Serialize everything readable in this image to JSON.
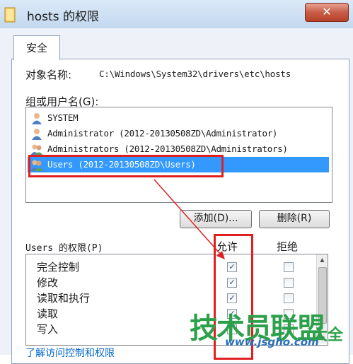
{
  "window": {
    "title": "hosts 的权限",
    "close_glyph": "✕"
  },
  "tabs": [
    {
      "label": "安全"
    }
  ],
  "object": {
    "label": "对象名称:",
    "value": "C:\\Windows\\System32\\drivers\\etc\\hosts"
  },
  "group": {
    "label": "组或用户名(G):",
    "items": [
      {
        "name": "SYSTEM",
        "icon": "user-icon"
      },
      {
        "name": "Administrator (2012-20130508ZD\\Administrator)",
        "icon": "user-icon"
      },
      {
        "name": "Administrators (2012-20130508ZD\\Administrators)",
        "icon": "users-icon"
      },
      {
        "name": "Users (2012-20130508ZD\\Users)",
        "icon": "users-icon",
        "selected": true
      }
    ]
  },
  "buttons": {
    "add": "添加(D)...",
    "remove": "删除(R)"
  },
  "permissions": {
    "label": "Users 的权限(P)",
    "allow_header": "允许",
    "deny_header": "拒绝",
    "rows": [
      {
        "name": "完全控制",
        "allow": true,
        "deny": false
      },
      {
        "name": "修改",
        "allow": true,
        "deny": false
      },
      {
        "name": "读取和执行",
        "allow": true,
        "deny": false
      },
      {
        "name": "读取",
        "allow": true,
        "deny": false
      },
      {
        "name": "写入",
        "allow": false,
        "deny": false
      }
    ]
  },
  "link": "了解访问控制和权限",
  "watermark": {
    "brand": "技术员联盟",
    "url": "www.jsgho.com",
    "big": "大全"
  },
  "colors": {
    "selection": "#3399ff",
    "highlight": "#e02020",
    "link": "#0066cc"
  }
}
